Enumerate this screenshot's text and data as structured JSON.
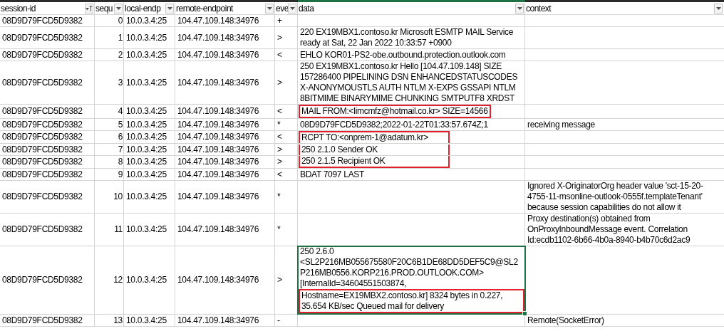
{
  "columns": [
    {
      "label": "session-id",
      "sorted": true,
      "active": false
    },
    {
      "label": "sequ",
      "sorted": false,
      "active": false
    },
    {
      "label": "local-endp",
      "sorted": false,
      "active": false
    },
    {
      "label": "remote-endpoint",
      "sorted": false,
      "active": false
    },
    {
      "label": "eve",
      "sorted": false,
      "active": false
    },
    {
      "label": "data",
      "sorted": false,
      "active": true
    },
    {
      "label": "context",
      "sorted": false,
      "active": false
    }
  ],
  "rows": [
    {
      "session_id": "08D9D79FCD5D9382",
      "seq": "0",
      "local": "10.0.3.4:25",
      "remote": "104.47.109.148:34976",
      "event": "+",
      "data": "",
      "context": "",
      "boxed": false,
      "selected": false
    },
    {
      "session_id": "08D9D79FCD5D9382",
      "seq": "1",
      "local": "10.0.3.4:25",
      "remote": "104.47.109.148:34976",
      "event": ">",
      "data": "220 EX19MBX1.contoso.kr Microsoft ESMTP MAIL Service ready at Sat, 22 Jan 2022 10:33:57 +0900",
      "context": "",
      "boxed": false,
      "selected": false
    },
    {
      "session_id": "08D9D79FCD5D9382",
      "seq": "2",
      "local": "10.0.3.4:25",
      "remote": "104.47.109.148:34976",
      "event": "<",
      "data": "EHLO KOR01-PS2-obe.outbound.protection.outlook.com",
      "context": "",
      "boxed": false,
      "selected": false
    },
    {
      "session_id": "08D9D79FCD5D9382",
      "seq": "3",
      "local": "10.0.3.4:25",
      "remote": "104.47.109.148:34976",
      "event": ">",
      "data": "250  EX19MBX1.contoso.kr Hello [104.47.109.148] SIZE 157286400 PIPELINING DSN ENHANCEDSTATUSCODES X-ANONYMOUSTLS AUTH NTLM X-EXPS GSSAPI NTLM 8BITMIME BINARYMIME CHUNKING SMTPUTF8 XRDST",
      "context": "",
      "boxed": false,
      "selected": false
    },
    {
      "session_id": "08D9D79FCD5D9382",
      "seq": "4",
      "local": "10.0.3.4:25",
      "remote": "104.47.109.148:34976",
      "event": "<",
      "data": "MAIL FROM:<limcmfz@hotmail.co.kr> SIZE=14566",
      "context": "",
      "boxed": true,
      "selected": false
    },
    {
      "session_id": "08D9D79FCD5D9382",
      "seq": "5",
      "local": "10.0.3.4:25",
      "remote": "104.47.109.148:34976",
      "event": "*",
      "data": "08D9D79FCD5D9382;2022-01-22T01:33:57.674Z;1",
      "context": "receiving message",
      "boxed": false,
      "selected": false
    },
    {
      "session_id": "08D9D79FCD5D9382",
      "seq": "6",
      "local": "10.0.3.4:25",
      "remote": "104.47.109.148:34976",
      "event": "<",
      "data": "RCPT TO:<onprem-1@adatum.kr>",
      "context": "",
      "boxed": true,
      "selected": false
    },
    {
      "session_id": "08D9D79FCD5D9382",
      "seq": "7",
      "local": "10.0.3.4:25",
      "remote": "104.47.109.148:34976",
      "event": ">",
      "data": "250 2.1.0 Sender OK",
      "context": "",
      "boxed": true,
      "selected": false
    },
    {
      "session_id": "08D9D79FCD5D9382",
      "seq": "8",
      "local": "10.0.3.4:25",
      "remote": "104.47.109.148:34976",
      "event": ">",
      "data": "250 2.1.5 Recipient OK",
      "context": "",
      "boxed": true,
      "selected": false
    },
    {
      "session_id": "08D9D79FCD5D9382",
      "seq": "9",
      "local": "10.0.3.4:25",
      "remote": "104.47.109.148:34976",
      "event": "<",
      "data": "BDAT 7097 LAST",
      "context": "",
      "boxed": false,
      "selected": false
    },
    {
      "session_id": "08D9D79FCD5D9382",
      "seq": "10",
      "local": "10.0.3.4:25",
      "remote": "104.47.109.148:34976",
      "event": "*",
      "data": "",
      "context": "Ignored X-OriginatorOrg header value 'sct-15-20-4755-11-msonline-outlook-0555f.templateTenant' because session capabilities do not allow it",
      "boxed": false,
      "selected": false
    },
    {
      "session_id": "08D9D79FCD5D9382",
      "seq": "11",
      "local": "10.0.3.4:25",
      "remote": "104.47.109.148:34976",
      "event": "*",
      "data": "",
      "context": "Proxy destination(s) obtained from OnProxyInboundMessage event. Correlation Id:ecdb1102-6b66-4b0a-8940-b4b70c6d2ac9",
      "boxed": false,
      "selected": false
    },
    {
      "session_id": "08D9D79FCD5D9382",
      "seq": "12",
      "local": "10.0.3.4:25",
      "remote": "104.47.109.148:34976",
      "event": ">",
      "data": "250 2.6.0 <SL2P216MB055675580F20C6B1DE68DD5DEF5C9@SL2P216MB0556.KORP216.PROD.OUTLOOK.COM> [InternalId=34604551503874,",
      "data_boxed": "Hostname=EX19MBX2.contoso.kr] 8324 bytes in 0.227, 35.654 KB/sec Queued mail for delivery",
      "context": "",
      "boxed": false,
      "selected": true
    },
    {
      "session_id": "08D9D79FCD5D9382",
      "seq": "13",
      "local": "10.0.3.4:25",
      "remote": "104.47.109.148:34976",
      "event": "-",
      "data": "",
      "context": "Remote(SocketError)",
      "boxed": false,
      "selected": false
    }
  ]
}
